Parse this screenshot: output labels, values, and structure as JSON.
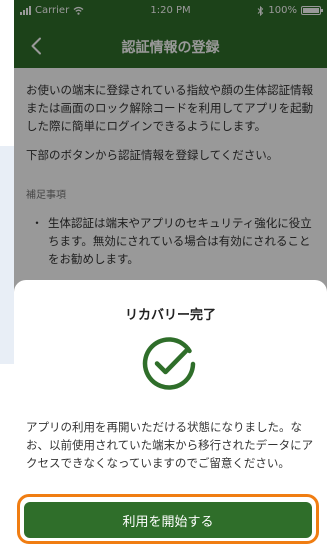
{
  "status_bar": {
    "carrier": "Carrier",
    "time": "1:20 PM",
    "battery": "100%"
  },
  "nav": {
    "title": "認証情報の登録",
    "back_icon": "chevron-left-icon"
  },
  "content": {
    "paragraph1": "お使いの端末に登録されている指紋や顔の生体認証情報または画面のロック解除コードを利用してアプリを起動した際に簡単にログインできるようにします。",
    "paragraph2": "下部のボタンから認証情報を登録してください。",
    "note_heading": "補足事項",
    "notes": [
      {
        "bullet": "・",
        "text": "生体認証は端末やアプリのセキュリティ強化に役立ちます。無効にされている場合は有効にされることをお勧めします。"
      }
    ]
  },
  "sheet": {
    "title": "リカバリー完了",
    "icon": "check-circle-icon",
    "message": "アプリの利用を再開いただける状態になりました。なお、以前使用されていた端末から移行されたデータにアクセスできなくなっていますのでご留意ください。",
    "button_label": "利用を開始する"
  },
  "colors": {
    "primary_green": "#2f6e2a",
    "highlight_orange": "#f07d12"
  }
}
